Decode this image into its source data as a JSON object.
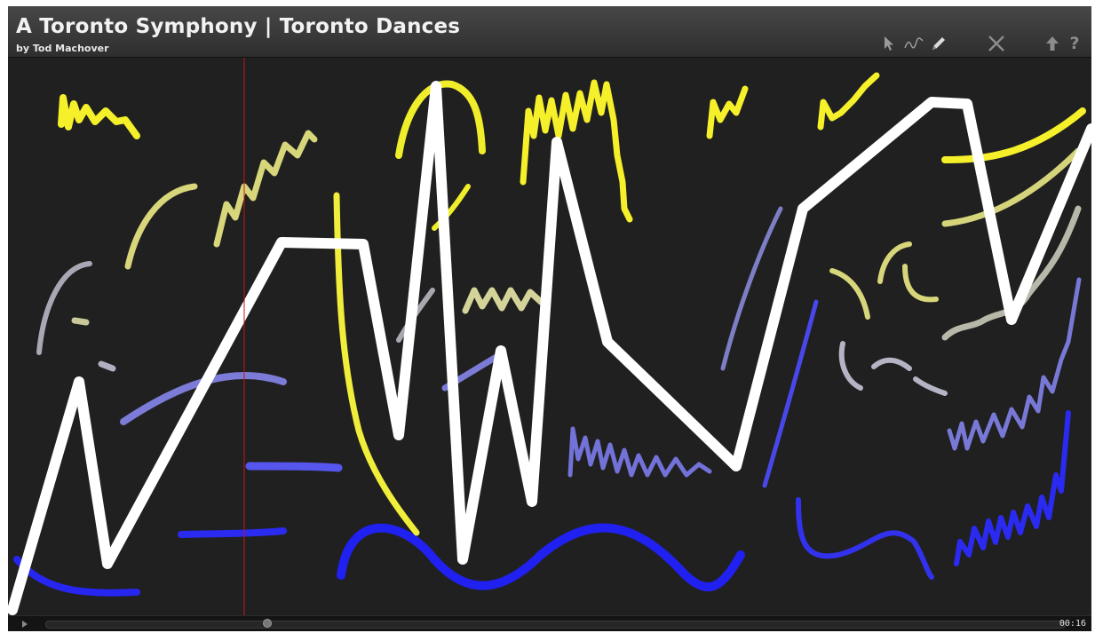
{
  "header": {
    "title": "A Toronto Symphony | Toronto Dances",
    "subtitle": "by Tod Machover"
  },
  "toolbar": {
    "icons": [
      "cursor-icon",
      "line-tool-icon",
      "pencil-icon",
      "close-icon",
      "up-arrow-icon",
      "help-icon"
    ],
    "help_label": "?"
  },
  "player": {
    "elapsed": "00:16",
    "progress_fraction": 0.25
  },
  "colors": {
    "white": "#ffffff",
    "yellow": "#f5f02a",
    "pale_yellow": "#d8d67a",
    "gray": "#a8a8b0",
    "lavender": "#8a8ad8",
    "blue": "#2626f0",
    "playhead": "#c81414"
  }
}
